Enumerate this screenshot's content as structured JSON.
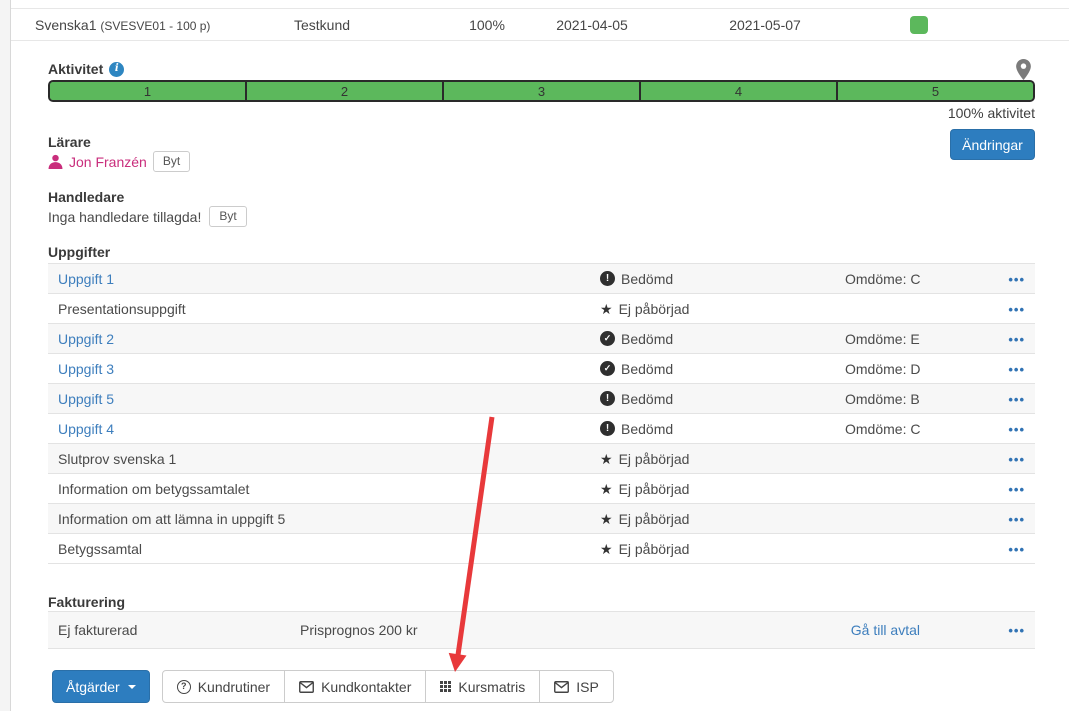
{
  "page": {
    "header_row": {
      "course_name": "Svenska1",
      "course_code": "(SVESVE01 - 100 p)",
      "customer": "Testkund",
      "progress": "100%",
      "start_date": "2021-04-05",
      "end_date": "2021-05-07",
      "status_color": "#5cb85c"
    },
    "activity": {
      "label": "Aktivitet",
      "info_icon": "info-circle-icon",
      "pin_icon": "map-marker-icon",
      "segments": [
        "1",
        "2",
        "3",
        "4",
        "5"
      ],
      "summary": "100% aktivitet",
      "bar_color": "#5cb85c"
    },
    "teacher": {
      "label": "Lärare",
      "icon": "person-icon",
      "name": "Jon Franzén",
      "change_label": "Byt",
      "accent": "#c92d7c"
    },
    "changes_button_label": "Ändringar",
    "supervisor": {
      "label": "Handledare",
      "empty_text": "Inga handledare tillagda!",
      "change_label": "Byt"
    },
    "assignments": {
      "label": "Uppgifter",
      "rows": [
        {
          "name": "Uppgift 1",
          "link": true,
          "icon": "exclamation-circle-icon",
          "status": "Bedömd",
          "grade": "Omdöme: C"
        },
        {
          "name": "Presentationsuppgift",
          "link": false,
          "icon": "star-icon",
          "status": "Ej påbörjad",
          "grade": ""
        },
        {
          "name": "Uppgift 2",
          "link": true,
          "icon": "check-circle-icon",
          "status": "Bedömd",
          "grade": "Omdöme: E"
        },
        {
          "name": "Uppgift 3",
          "link": true,
          "icon": "check-circle-icon",
          "status": "Bedömd",
          "grade": "Omdöme: D"
        },
        {
          "name": "Uppgift 5",
          "link": true,
          "icon": "exclamation-circle-icon",
          "status": "Bedömd",
          "grade": "Omdöme: B"
        },
        {
          "name": "Uppgift 4",
          "link": true,
          "icon": "exclamation-circle-icon",
          "status": "Bedömd",
          "grade": "Omdöme: C"
        },
        {
          "name": "Slutprov svenska 1",
          "link": false,
          "icon": "star-icon",
          "status": "Ej påbörjad",
          "grade": ""
        },
        {
          "name": "Information om betygssamtalet",
          "link": false,
          "icon": "star-icon",
          "status": "Ej påbörjad",
          "grade": ""
        },
        {
          "name": "Information om att lämna in uppgift 5",
          "link": false,
          "icon": "star-icon",
          "status": "Ej påbörjad",
          "grade": ""
        },
        {
          "name": "Betygssamtal",
          "link": false,
          "icon": "star-icon",
          "status": "Ej påbörjad",
          "grade": ""
        }
      ]
    },
    "billing": {
      "label": "Fakturering",
      "status": "Ej fakturerad",
      "forecast": "Prisprognos 200 kr",
      "link_label": "Gå till avtal"
    },
    "footer": {
      "actions_label": "Åtgärder",
      "buttons": [
        {
          "label": "Kundrutiner",
          "icon": "question-circle-icon"
        },
        {
          "label": "Kundkontakter",
          "icon": "envelope-icon"
        },
        {
          "label": "Kursmatris",
          "icon": "grid-icon"
        },
        {
          "label": "ISP",
          "icon": "envelope-icon"
        }
      ]
    },
    "annotation": {
      "type": "red-arrow",
      "points_to": "Kursmatris",
      "color": "#e8393b"
    },
    "colors": {
      "link": "#3d7ebd",
      "primary_button": "#2d7dbf",
      "green": "#5cb85c",
      "pink": "#c92d7c",
      "red_arrow": "#e8393b"
    }
  }
}
